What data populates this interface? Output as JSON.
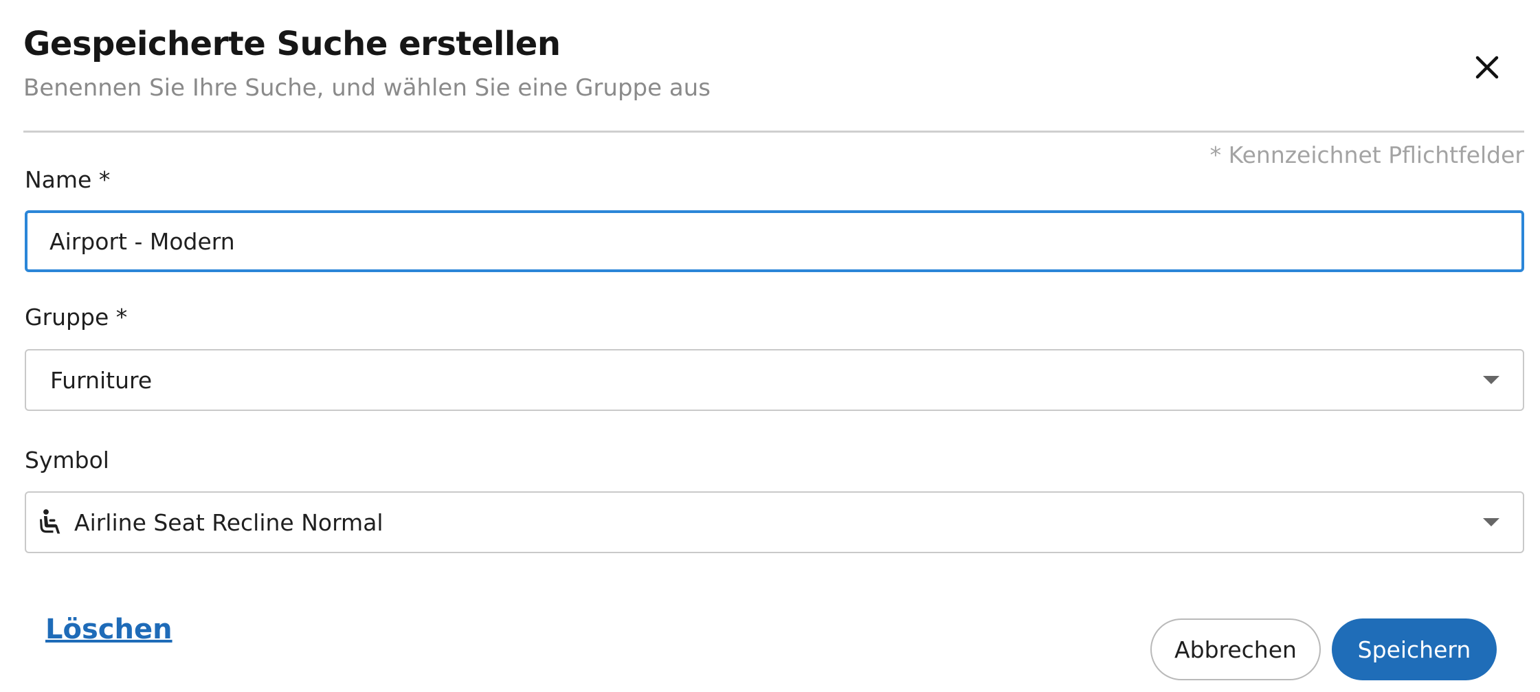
{
  "dialog": {
    "title": "Gespeicherte Suche erstellen",
    "subtitle": "Benennen Sie Ihre Suche, und wählen Sie eine Gruppe aus",
    "close_icon": "close-icon",
    "required_note": "* Kennzeichnet Pflichtfelder"
  },
  "form": {
    "name": {
      "label": "Name *",
      "value": "Airport - Modern"
    },
    "group": {
      "label": "Gruppe *",
      "value": "Furniture"
    },
    "symbol": {
      "label": "Symbol",
      "value": "Airline Seat Recline Normal",
      "icon": "airline-seat-recline-normal-icon"
    }
  },
  "actions": {
    "delete_label": "Löschen",
    "cancel_label": "Abbrechen",
    "save_label": "Speichern"
  },
  "colors": {
    "accent": "#2b86d8",
    "primary_button": "#1f6db8",
    "link": "#1e6bb8"
  }
}
